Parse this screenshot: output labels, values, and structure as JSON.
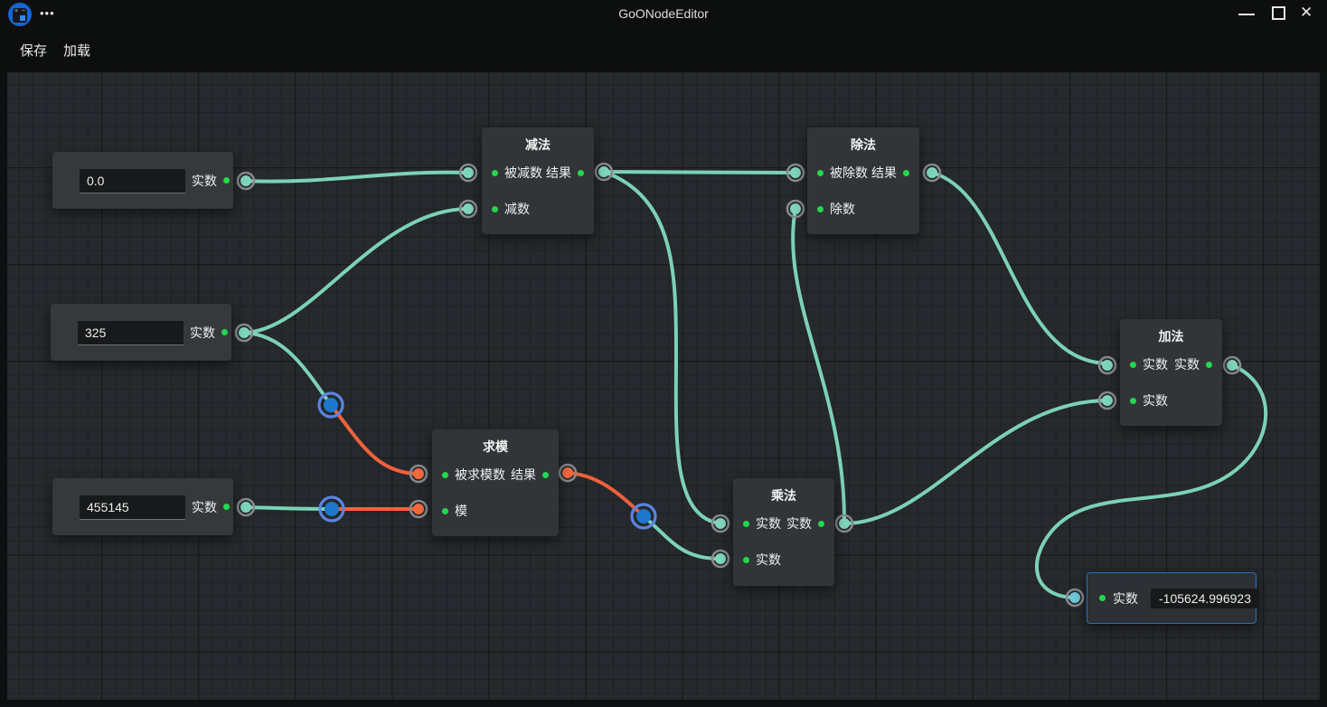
{
  "window": {
    "title": "GoONodeEditor",
    "more_menu": "•••",
    "controls": {
      "close_glyph": "✕"
    }
  },
  "menu": {
    "save": "保存",
    "load": "加载"
  },
  "colors": {
    "wire_teal": "#7cd1b8",
    "wire_orange": "#f2613b",
    "port_teal": "#7fd5bc",
    "port_orange": "#f2693f",
    "type_dot_green": "#23d84b",
    "reroute_blue_fill": "#1d78cc",
    "reroute_blue_ring": "#5b84e0",
    "node_bg": "#323538",
    "canvas_bg": "#26292d",
    "selected_border": "#2d6fb5"
  },
  "nodes": {
    "input_a": {
      "value": "0.0",
      "label": "实数"
    },
    "input_b": {
      "value": "325",
      "label": "实数"
    },
    "input_c": {
      "value": "455145",
      "label": "实数"
    },
    "subtract": {
      "title": "减法",
      "inputs": [
        "被减数",
        "减数"
      ],
      "output": "结果"
    },
    "divide": {
      "title": "除法",
      "inputs": [
        "被除数",
        "除数"
      ],
      "output": "结果"
    },
    "modulo": {
      "title": "求模",
      "inputs": [
        "被求模数",
        "模"
      ],
      "output": "结果"
    },
    "multiply": {
      "title": "乘法",
      "inputs": [
        "实数",
        "实数"
      ],
      "output": "实数"
    },
    "add": {
      "title": "加法",
      "inputs": [
        "实数",
        "实数"
      ],
      "output": "实数"
    },
    "output": {
      "label": "实数",
      "value": "-105624.996923"
    }
  }
}
